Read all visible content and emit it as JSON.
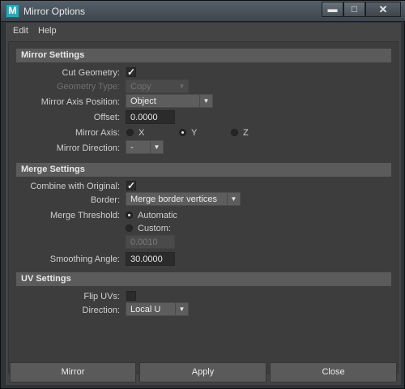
{
  "window": {
    "title": "Mirror Options",
    "app_icon": "maya-icon",
    "min_glyph": "▬",
    "max_glyph": "□",
    "close_glyph": "✕"
  },
  "menu": {
    "edit": "Edit",
    "help": "Help"
  },
  "mirror_settings": {
    "header": "Mirror Settings",
    "cut_geometry": {
      "label": "Cut Geometry:",
      "checked": true
    },
    "geometry_type": {
      "label": "Geometry Type:",
      "value": "Copy",
      "enabled": false
    },
    "mirror_axis_position": {
      "label": "Mirror Axis Position:",
      "value": "Object"
    },
    "offset": {
      "label": "Offset:",
      "value": "0.0000"
    },
    "mirror_axis": {
      "label": "Mirror Axis:",
      "options": [
        "X",
        "Y",
        "Z"
      ],
      "selected": "Y"
    },
    "mirror_direction": {
      "label": "Mirror Direction:",
      "value": "-"
    }
  },
  "merge_settings": {
    "header": "Merge Settings",
    "combine_with_original": {
      "label": "Combine with Original:",
      "checked": true
    },
    "border": {
      "label": "Border:",
      "value": "Merge border vertices"
    },
    "merge_threshold": {
      "label": "Merge Threshold:",
      "options": [
        "Automatic",
        "Custom:"
      ],
      "selected": "Automatic"
    },
    "custom_value": {
      "value": "0.0010",
      "enabled": false
    },
    "smoothing_angle": {
      "label": "Smoothing Angle:",
      "value": "30.0000"
    }
  },
  "uv_settings": {
    "header": "UV Settings",
    "flip_uvs": {
      "label": "Flip UVs:",
      "checked": false
    },
    "direction": {
      "label": "Direction:",
      "value": "Local U"
    }
  },
  "buttons": {
    "mirror": "Mirror",
    "apply": "Apply",
    "close": "Close"
  },
  "glyphs": {
    "check": "✓",
    "dropdown": "▼"
  }
}
